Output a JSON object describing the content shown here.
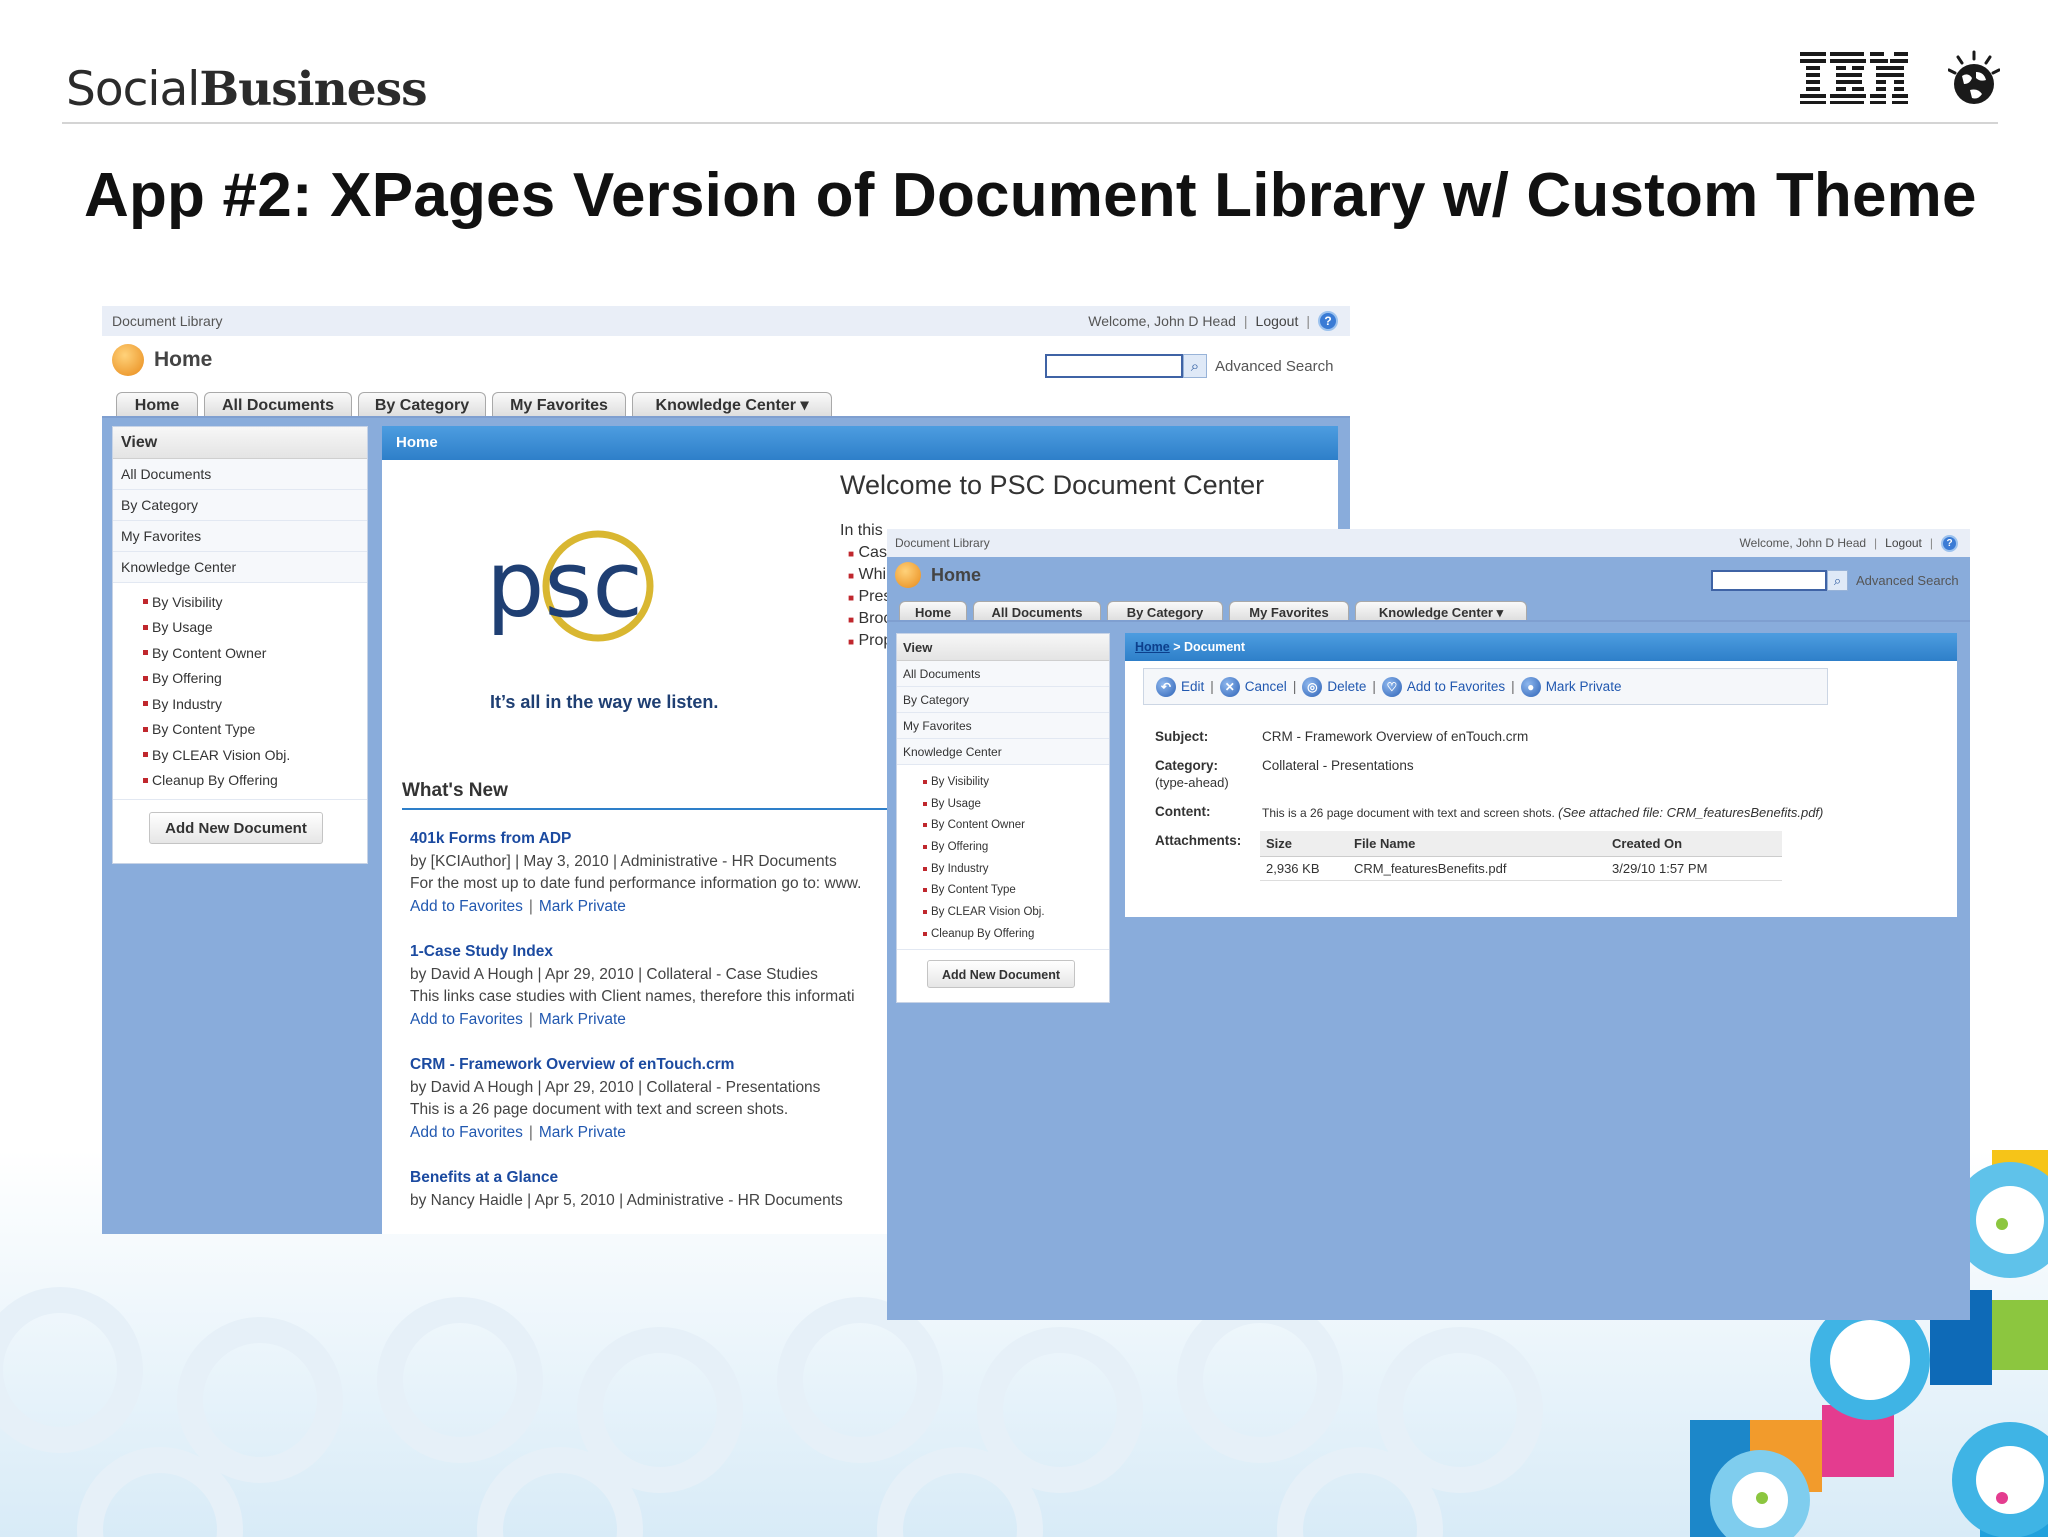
{
  "slide": {
    "brand_social": "Social",
    "brand_business": "Business",
    "ibm_logo": "IBM",
    "title": "App #2: XPages Version of Document Library w/ Custom Theme"
  },
  "app1": {
    "app_name": "Document Library",
    "welcome": "Welcome, John D Head",
    "logout": "Logout",
    "help_icon": "?",
    "page_heading": "Home",
    "search_placeholder": "",
    "advanced_search": "Advanced Search",
    "tabs": [
      "Home",
      "All Documents",
      "By Category",
      "My Favorites",
      "Knowledge Center ▾"
    ],
    "sidebar": {
      "head": "View",
      "items": [
        "All Documents",
        "By Category",
        "My Favorites",
        "Knowledge Center"
      ],
      "sub_items": [
        "By Visibility",
        "By Usage",
        "By Content Owner",
        "By Offering",
        "By Industry",
        "By Content Type",
        "By CLEAR Vision Obj.",
        "Cleanup By Offering"
      ],
      "add_button": "Add New Document"
    },
    "panel_head": "Home",
    "logo_text": "psc",
    "logo_tagline": "It’s all in the way we listen.",
    "welcome_heading": "Welcome to PSC Document Center",
    "intro_prefix": "In this",
    "intro_bullets": [
      "Cas",
      "Whi",
      "Pres",
      "Broc",
      "Prop"
    ],
    "whats_new": "What's New",
    "news": [
      {
        "title": "401k Forms from ADP",
        "meta": "by [KCIAuthor]  |  May 3, 2010  |  Administrative - HR Documents",
        "desc": "For the most up to date fund performance information go to: www.",
        "fav": "Add to Favorites",
        "priv": "Mark Private"
      },
      {
        "title": "1-Case Study Index",
        "meta": "by David A Hough  |  Apr 29, 2010  |  Collateral - Case Studies",
        "desc": "This links case studies with Client names, therefore this informati",
        "fav": "Add to Favorites",
        "priv": "Mark Private"
      },
      {
        "title": "CRM - Framework Overview of enTouch.crm",
        "meta": "by David A Hough  |  Apr 29, 2010  |  Collateral - Presentations",
        "desc": "This is a 26 page document with text and screen shots.",
        "fav": "Add to Favorites",
        "priv": "Mark Private"
      },
      {
        "title": "Benefits at a Glance",
        "meta": "by Nancy Haidle  |  Apr 5, 2010  |  Administrative - HR Documents",
        "desc": "",
        "fav": "",
        "priv": ""
      }
    ]
  },
  "app2": {
    "app_name": "Document Library",
    "welcome": "Welcome, John D Head",
    "logout": "Logout",
    "help_icon": "?",
    "page_heading": "Home",
    "advanced_search": "Advanced Search",
    "tabs": [
      "Home",
      "All Documents",
      "By Category",
      "My Favorites",
      "Knowledge Center ▾"
    ],
    "sidebar": {
      "head": "View",
      "items": [
        "All Documents",
        "By Category",
        "My Favorites",
        "Knowledge Center"
      ],
      "sub_items": [
        "By Visibility",
        "By Usage",
        "By Content Owner",
        "By Offering",
        "By Industry",
        "By Content Type",
        "By CLEAR Vision Obj.",
        "Cleanup By Offering"
      ],
      "add_button": "Add New Document"
    },
    "breadcrumb_home": "Home",
    "breadcrumb_sep": " > ",
    "breadcrumb_current": "Document",
    "actions": [
      "Edit",
      "Cancel",
      "Delete",
      "Add to Favorites",
      "Mark Private"
    ],
    "fields": {
      "subject_label": "Subject:",
      "subject_value": "CRM - Framework Overview of enTouch.crm",
      "category_label": "Category:",
      "category_sub": "(type-ahead)",
      "category_value": "Collateral - Presentations",
      "content_label": "Content:",
      "content_value": "This is a 26 page document with text and screen shots.",
      "content_note": "(See attached file: CRM_featuresBenefits.pdf)",
      "attachments_label": "Attachments:"
    },
    "attachments": {
      "headers": [
        "Size",
        "File Name",
        "Created On"
      ],
      "rows": [
        [
          "2,936 KB",
          "CRM_featuresBenefits.pdf",
          "3/29/10 1:57 PM"
        ]
      ]
    }
  }
}
